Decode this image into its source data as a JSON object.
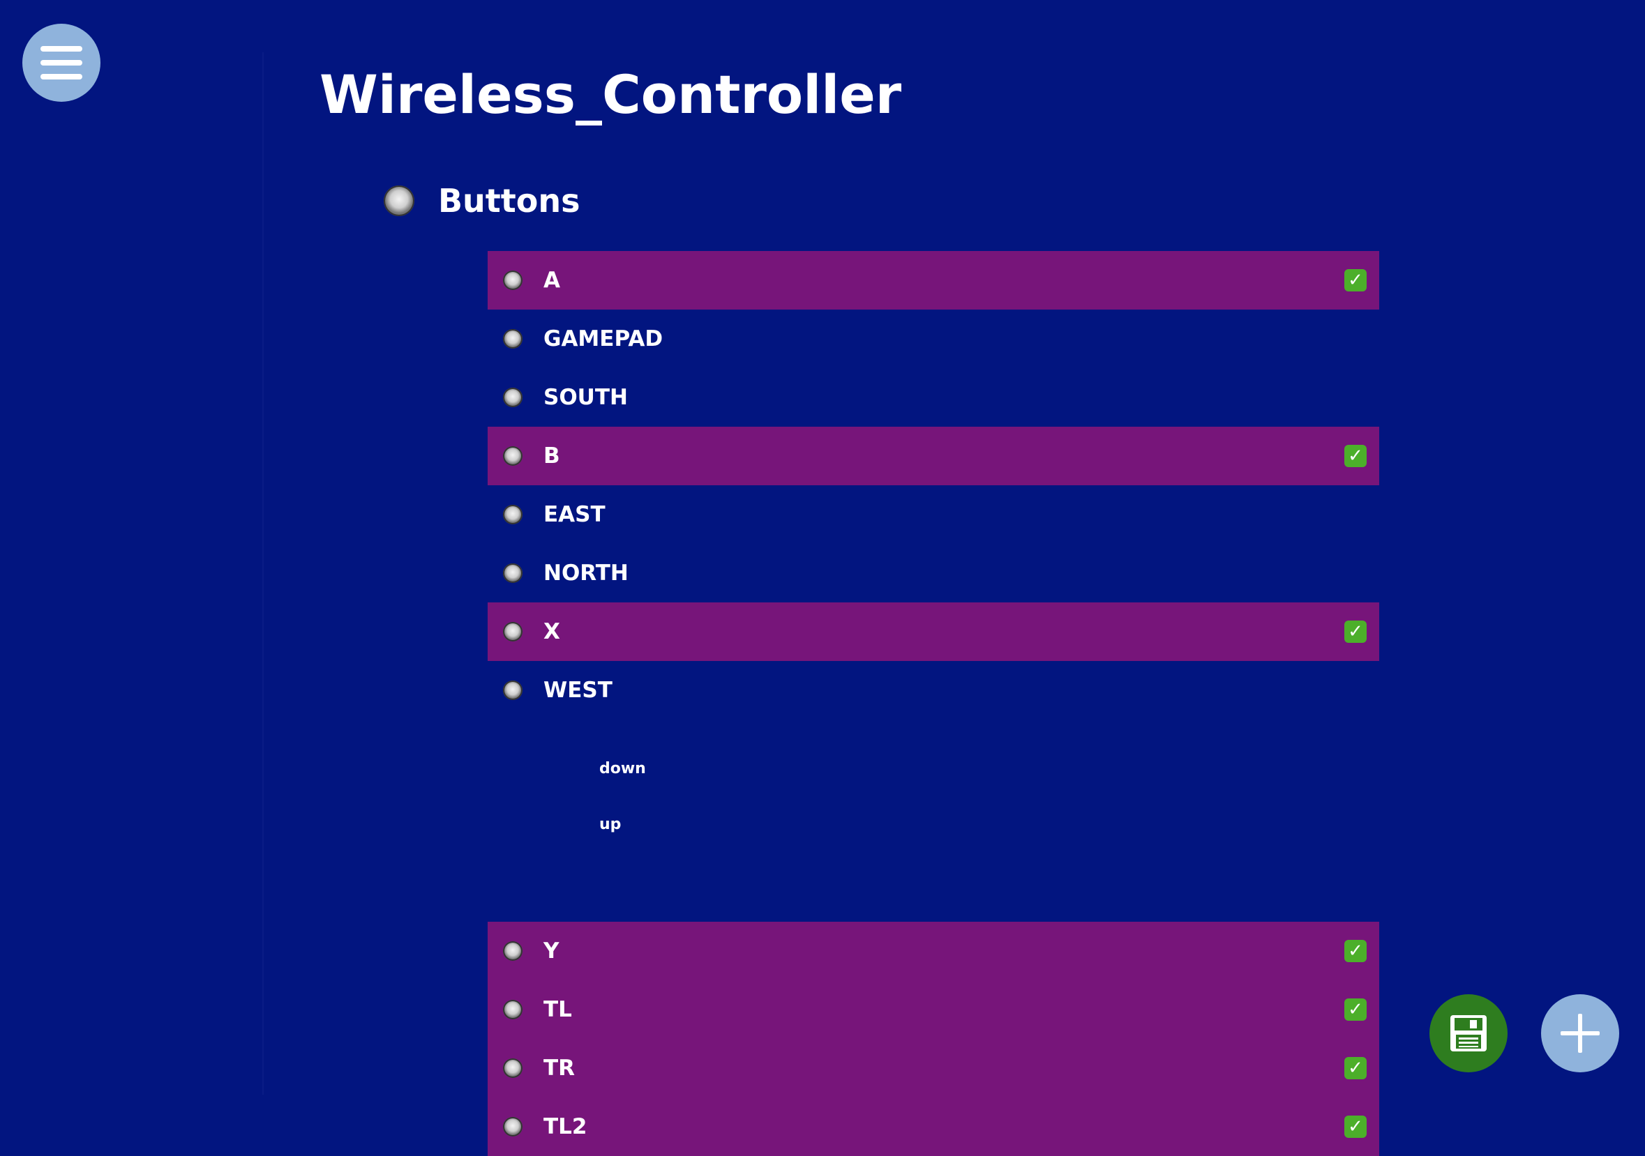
{
  "page_title": "Wireless_Controller",
  "group": {
    "label": "Buttons"
  },
  "rows": [
    {
      "label": "A",
      "selected": true
    },
    {
      "label": "GAMEPAD",
      "selected": false
    },
    {
      "label": "SOUTH",
      "selected": false
    },
    {
      "label": "B",
      "selected": true
    },
    {
      "label": "EAST",
      "selected": false
    },
    {
      "label": "NORTH",
      "selected": false
    },
    {
      "label": "X",
      "selected": true
    },
    {
      "label": "WEST",
      "selected": false
    },
    {
      "label": "Y",
      "selected": true
    },
    {
      "label": "TL",
      "selected": true
    },
    {
      "label": "TR",
      "selected": true
    },
    {
      "label": "TL2",
      "selected": true
    }
  ],
  "sub_options": [
    "down",
    "up"
  ],
  "icons": {
    "menu": "hamburger-menu-icon",
    "save": "floppy-disk-icon",
    "add": "plus-icon",
    "check": "check-mark-icon"
  },
  "colors": {
    "background": "#021580",
    "selected_row": "#77157a",
    "menu_fab": "#8fb3dc",
    "save_fab": "#2e7d1f",
    "check": "#4caf2a"
  }
}
